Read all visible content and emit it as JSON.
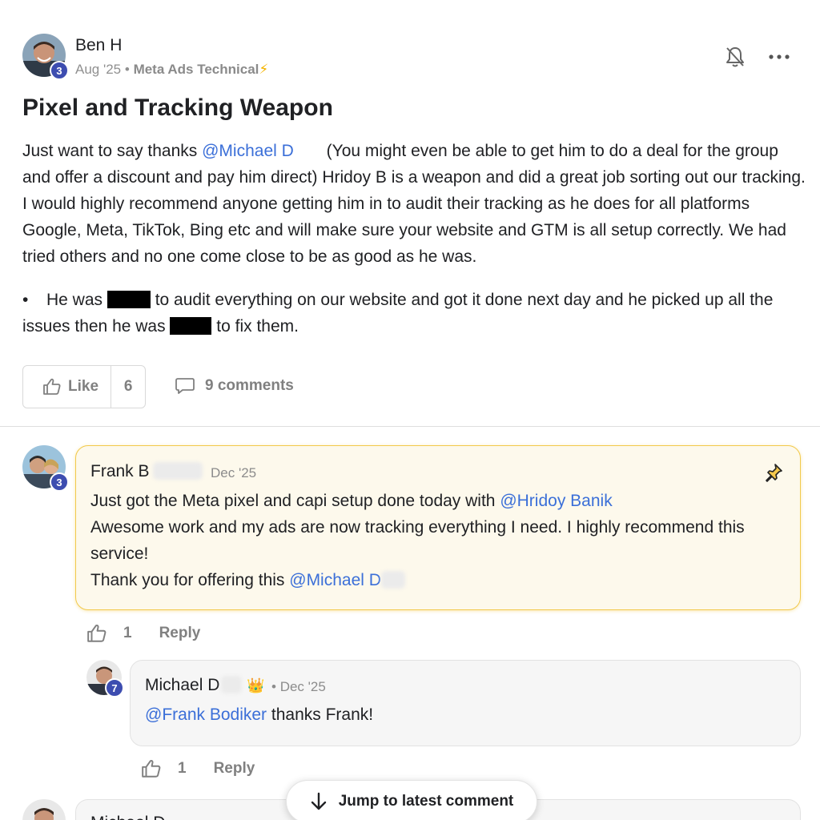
{
  "post": {
    "author": "Ben H",
    "level": "3",
    "date": "Aug '25",
    "separator": "•",
    "group": "Meta Ads Technical",
    "group_emoji": "⚡",
    "title": "Pixel and Tracking Weapon",
    "body": {
      "part1": "Just want to say thanks ",
      "mention": "@Michael D",
      "part2": "       (You might even be able to get him to do a deal for the group and offer a discount and pay him direct) Hridoy B is a weapon and did a great job sorting out our tracking. I would highly recommend anyone getting him in to audit their tracking as he does for all platforms Google, Meta, TikTok, Bing etc and will make sure your website and GTM is all setup correctly. We had tried others and no one come close to be as good as he was."
    },
    "bullet": {
      "dot": "•",
      "part1": "He was ",
      "part2": " to audit everything on our website and got it done next day and he picked up all the issues then he was ",
      "part3": " to fix them."
    },
    "like_label": "Like",
    "like_count": "6",
    "comments_label": "9 comments"
  },
  "comments": [
    {
      "author": "Frank B",
      "level": "3",
      "date": "Dec '25",
      "line1_text": "Just got the Meta pixel and capi setup done today with ",
      "line1_mention": "@Hridoy Banik",
      "line2": "Awesome work and my ads are now tracking everything I need. I highly recommend this service!",
      "line3_text": "Thank you for offering this ",
      "line3_mention": "@Michael D",
      "like_count": "1",
      "reply_label": "Reply"
    },
    {
      "author": "Michael D",
      "level": "7",
      "crown": "👑",
      "separator": "•",
      "date": "Dec '25",
      "mention": "@Frank Bodiker",
      "text": " thanks Frank!",
      "like_count": "1",
      "reply_label": "Reply"
    }
  ],
  "next_comment": {
    "author_partial": "Michael D"
  },
  "jump_button": "Jump to latest comment",
  "colors": {
    "mention": "#3b6fd8",
    "badge": "#3d4db0",
    "pinned_border": "#f2c94c"
  },
  "icons": [
    "bell-off-icon",
    "more-dots-icon",
    "thumbs-up-icon",
    "comment-icon",
    "pin-icon",
    "arrow-down-icon"
  ]
}
